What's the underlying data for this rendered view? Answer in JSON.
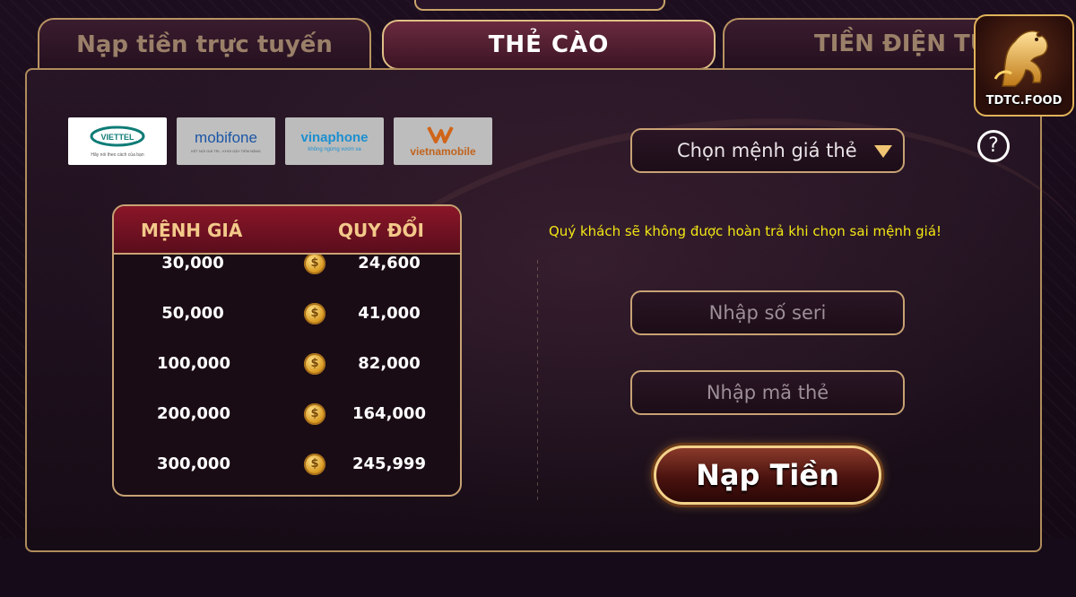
{
  "tabs": {
    "online": "Nạp tiền trực tuyến",
    "card": "THẺ CÀO",
    "crypto": "TIỀN ĐIỆN TỬ"
  },
  "logo": {
    "text": "TDTC.FOOD",
    "icon": "golden-horse-icon"
  },
  "carriers": [
    {
      "name": "viettel",
      "brand": "VIETTEL",
      "tagline": "Hãy nói theo cách của bạn",
      "color": "#0f7c77"
    },
    {
      "name": "mobifone",
      "brand": "mobifone",
      "tagline": "KẾT NỐI GIÁ TRỊ - KHƠI DẬY TIỀM NĂNG",
      "color": "#1b56a5"
    },
    {
      "name": "vinaphone",
      "brand": "vinaphone",
      "tagline": "không ngừng vươn xa",
      "color": "#1d8fd0"
    },
    {
      "name": "vietnamobile",
      "brand": "vietnamobile",
      "color": "#d0651a"
    }
  ],
  "rate_table": {
    "head_denom": "MỆNH GIÁ",
    "head_value": "QUY ĐỔI",
    "rows": [
      {
        "denom": "30,000",
        "value": "24,600"
      },
      {
        "denom": "50,000",
        "value": "41,000"
      },
      {
        "denom": "100,000",
        "value": "82,000"
      },
      {
        "denom": "200,000",
        "value": "164,000"
      },
      {
        "denom": "300,000",
        "value": "245,999"
      }
    ],
    "coin_symbol": "$"
  },
  "form": {
    "select_label": "Chọn mệnh giá thẻ",
    "seri_placeholder": "Nhập số seri",
    "code_placeholder": "Nhập mã thẻ",
    "warning": "Quý khách sẽ không được hoàn trả khi chọn sai mệnh giá!",
    "submit": "Nạp Tiền",
    "help": "?"
  },
  "colors": {
    "accent_gold": "#c8a274",
    "warning_yellow": "#f2e614",
    "header_red": "#8a1628"
  }
}
